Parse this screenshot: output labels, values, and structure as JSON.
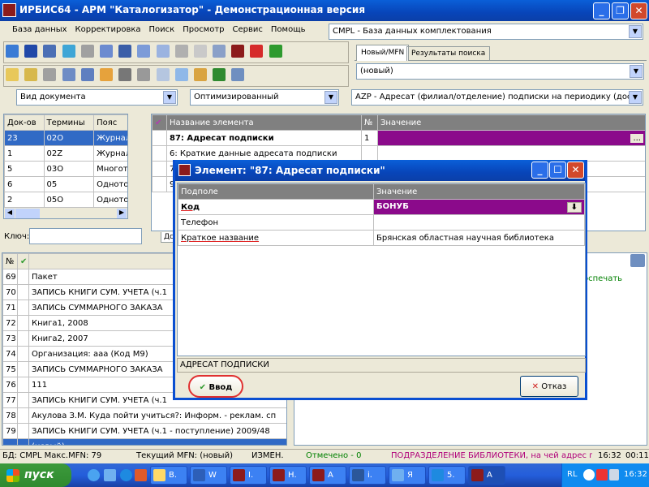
{
  "window": {
    "title": "ИРБИС64 - АРМ \"Каталогизатор\" - Демонстрационная версия"
  },
  "menu": [
    "База данных",
    "Корректировка",
    "Поиск",
    "Просмотр",
    "Сервис",
    "Помощь"
  ],
  "database_combo": {
    "value": "CMPL - База данных комплектования"
  },
  "tabs": [
    "Новый/MFN",
    "Результаты поиска"
  ],
  "record_combo": {
    "value": "(новый)"
  },
  "view_combo": {
    "value": "Вид документа"
  },
  "mode_combo": {
    "value": "Оптимизированный"
  },
  "field_combo": {
    "value": "AZP - Адресат (филиал/отделение) подписки на периодику (доста"
  },
  "dict_table": {
    "headers": [
      "Док-ов",
      "Термины",
      "Пояс"
    ],
    "rows": [
      {
        "count": "23",
        "term": "02O",
        "desc": "Журнал о"
      },
      {
        "count": "1",
        "term": "02Z",
        "desc": "Журнал и"
      },
      {
        "count": "5",
        "term": "03O",
        "desc": "Многотом"
      },
      {
        "count": "6",
        "term": "05",
        "desc": "Однотомн"
      },
      {
        "count": "2",
        "term": "05O",
        "desc": "Однотомн"
      }
    ]
  },
  "key_label": "Ключ:",
  "elements_table": {
    "headers": {
      "name": "Название элемента",
      "num": "№",
      "value": "Значение"
    },
    "rows": [
      {
        "name": "87: Адресат подписки",
        "num": "1"
      },
      {
        "name": "6: Краткие данные адресата подписки",
        "num": ""
      },
      {
        "name": "7",
        "num": ""
      },
      {
        "name": "9",
        "num": ""
      }
    ]
  },
  "records_list": {
    "headers": [
      "№"
    ],
    "rows": [
      {
        "num": "69",
        "text": "Пакет"
      },
      {
        "num": "70",
        "text": "ЗАПИСЬ КНИГИ СУМ. УЧЕТА (ч.1"
      },
      {
        "num": "71",
        "text": "ЗАПИСЬ СУММАРНОГО ЗАКАЗА"
      },
      {
        "num": "72",
        "text": "Книга1, 2008"
      },
      {
        "num": "73",
        "text": "Книга2, 2007"
      },
      {
        "num": "74",
        "text": "Организация: ааа (Код M9)"
      },
      {
        "num": "75",
        "text": "ЗАПИСЬ СУММАРНОГО ЗАКАЗА"
      },
      {
        "num": "76",
        "text": "111"
      },
      {
        "num": "77",
        "text": "ЗАПИСЬ КНИГИ СУМ. УЧЕТА (ч.1"
      },
      {
        "num": "78",
        "text": "Акулова З.М. Куда пойти учиться?: Информ. - реклам. сп"
      },
      {
        "num": "79",
        "text": "ЗАПИСЬ КНИГИ СУМ. УЧЕТА (ч.1 - поступление) 2009/48"
      }
    ],
    "selected": "(новый)"
  },
  "right_panel": {
    "text": "оспечать"
  },
  "left_tab": "Дс",
  "dialog": {
    "title": "Элемент: \"87: Адресат подписки\"",
    "headers": {
      "sub": "Подполе",
      "value": "Значение"
    },
    "rows": [
      {
        "sub": "Код",
        "value": "БОНУБ"
      },
      {
        "sub": "Телефон",
        "value": ""
      },
      {
        "sub": "Краткое название",
        "value": "Брянская областная научная библиотека"
      }
    ],
    "footer": "АДРЕСАТ ПОДПИСКИ",
    "ok": "Ввод",
    "cancel": "Отказ"
  },
  "status": {
    "db": "БД: CMPL Макс.MFN: 79",
    "mfn": "Текущий MFN: (новый)",
    "changed": "ИЗМЕН.",
    "marked": "Отмечено - 0",
    "hint": "ПОДРАЗДЕЛЕНИЕ БИБЛИОТЕКИ, на чей адрес п",
    "time1": "16:32",
    "time2": "00:11"
  },
  "taskbar": {
    "start": "пуск",
    "tasks": [
      "В.",
      "W",
      "I.",
      "Н.",
      "А",
      "i.",
      "Я",
      "5.",
      "А"
    ],
    "lang": "RL",
    "clock": "16:32"
  },
  "colors": {
    "accent": "#0a5fd8",
    "selection": "#316ac5",
    "highlight": "#8b0a8b",
    "status_green": "#008000",
    "status_magenta": "#b0007a"
  }
}
